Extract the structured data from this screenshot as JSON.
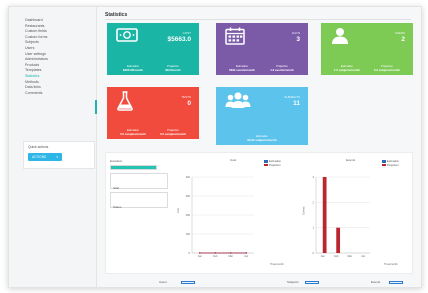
{
  "sidebar": {
    "items": [
      {
        "label": "Dashboard"
      },
      {
        "label": "Restaurants"
      },
      {
        "label": "Custom fields"
      },
      {
        "label": "Custom forms"
      },
      {
        "label": "Subjects"
      },
      {
        "label": "Users"
      },
      {
        "label": "User settings"
      },
      {
        "label": "Administrators"
      },
      {
        "label": "Products"
      },
      {
        "label": "Templates"
      },
      {
        "label": "Statistics"
      },
      {
        "label": "Methods"
      },
      {
        "label": "Data links"
      },
      {
        "label": "Comments"
      }
    ],
    "active_index": 10,
    "panel": {
      "title": "Quick actions",
      "select_value": "ACTIONS"
    }
  },
  "page": {
    "title": "Statistics"
  },
  "cards": [
    {
      "color": "#1bb5a6",
      "icon": "money-icon",
      "label": "COST",
      "value": "$5663.0",
      "foot_left_label": "Estimation",
      "foot_left_value": "$465.00/month",
      "foot_right_label": "Projection",
      "foot_right_value": "$8.0/month"
    },
    {
      "color": "#7b5ba8",
      "icon": "calendar-icon",
      "label": "DAYS",
      "value": "3",
      "foot_left_label": "Estimation",
      "foot_left_value": "5690 events/month",
      "foot_right_label": "Projection",
      "foot_right_value": "1.0 events/month"
    },
    {
      "color": "#7dca55",
      "icon": "user-icon",
      "label": "USERS",
      "value": "2",
      "foot_left_label": "Estimation",
      "foot_left_value": "7.0 subjects/month",
      "foot_right_label": "Projection",
      "foot_right_value": "0.0 subjects/month"
    },
    {
      "color": "#f04b3c",
      "icon": "flask-icon",
      "label": "TESTS",
      "value": "0",
      "foot_left_label": "Estimation",
      "foot_left_value": "0.0 samples/month",
      "foot_right_label": "Projection",
      "foot_right_value": "0.0 samples/month"
    },
    {
      "color": "#5cc3ec",
      "icon": "group-icon",
      "label": "SUBJECTS",
      "value": "11",
      "foot_left_label": "Estimation",
      "foot_left_value": "99.00 subjects/month",
      "foot_right_label": "",
      "foot_right_value": ""
    }
  ],
  "filters": {
    "first_label": "Evolution",
    "first_progress": 1.0,
    "second_label": "Start",
    "third_label": "Status"
  },
  "chart_data": [
    {
      "type": "line",
      "title": "Cost",
      "categories": [
        "Jan",
        "Feb",
        "Mar",
        "Apr"
      ],
      "series": [
        {
          "name": "Estimation",
          "color": "#2f6bb3",
          "values": [
            0,
            0,
            0,
            0
          ]
        },
        {
          "name": "Projection",
          "color": "#b9262d",
          "values": [
            0,
            0,
            0,
            0
          ]
        }
      ],
      "ylim": [
        0,
        400
      ],
      "yticks": [
        "400",
        "300",
        "200",
        "100",
        "0"
      ],
      "ylabel": "Cost",
      "xlabel": "Time/month"
    },
    {
      "type": "bar",
      "title": "Events",
      "categories": [
        "Jan",
        "Feb",
        "Mar",
        "Apr"
      ],
      "series": [
        {
          "name": "Estimation",
          "color": "#2f6bb3",
          "values": [
            0,
            0,
            0,
            0
          ]
        },
        {
          "name": "Projection",
          "color": "#b9262d",
          "values": [
            3,
            1,
            0,
            0
          ]
        }
      ],
      "ylim": [
        0,
        3
      ],
      "yticks": [
        "3",
        "2",
        "1",
        "0"
      ],
      "ylabel": "Events",
      "xlabel": "Time/month"
    }
  ],
  "bottom_strip": {
    "items": [
      "Users",
      "Subjects",
      "Events"
    ]
  }
}
